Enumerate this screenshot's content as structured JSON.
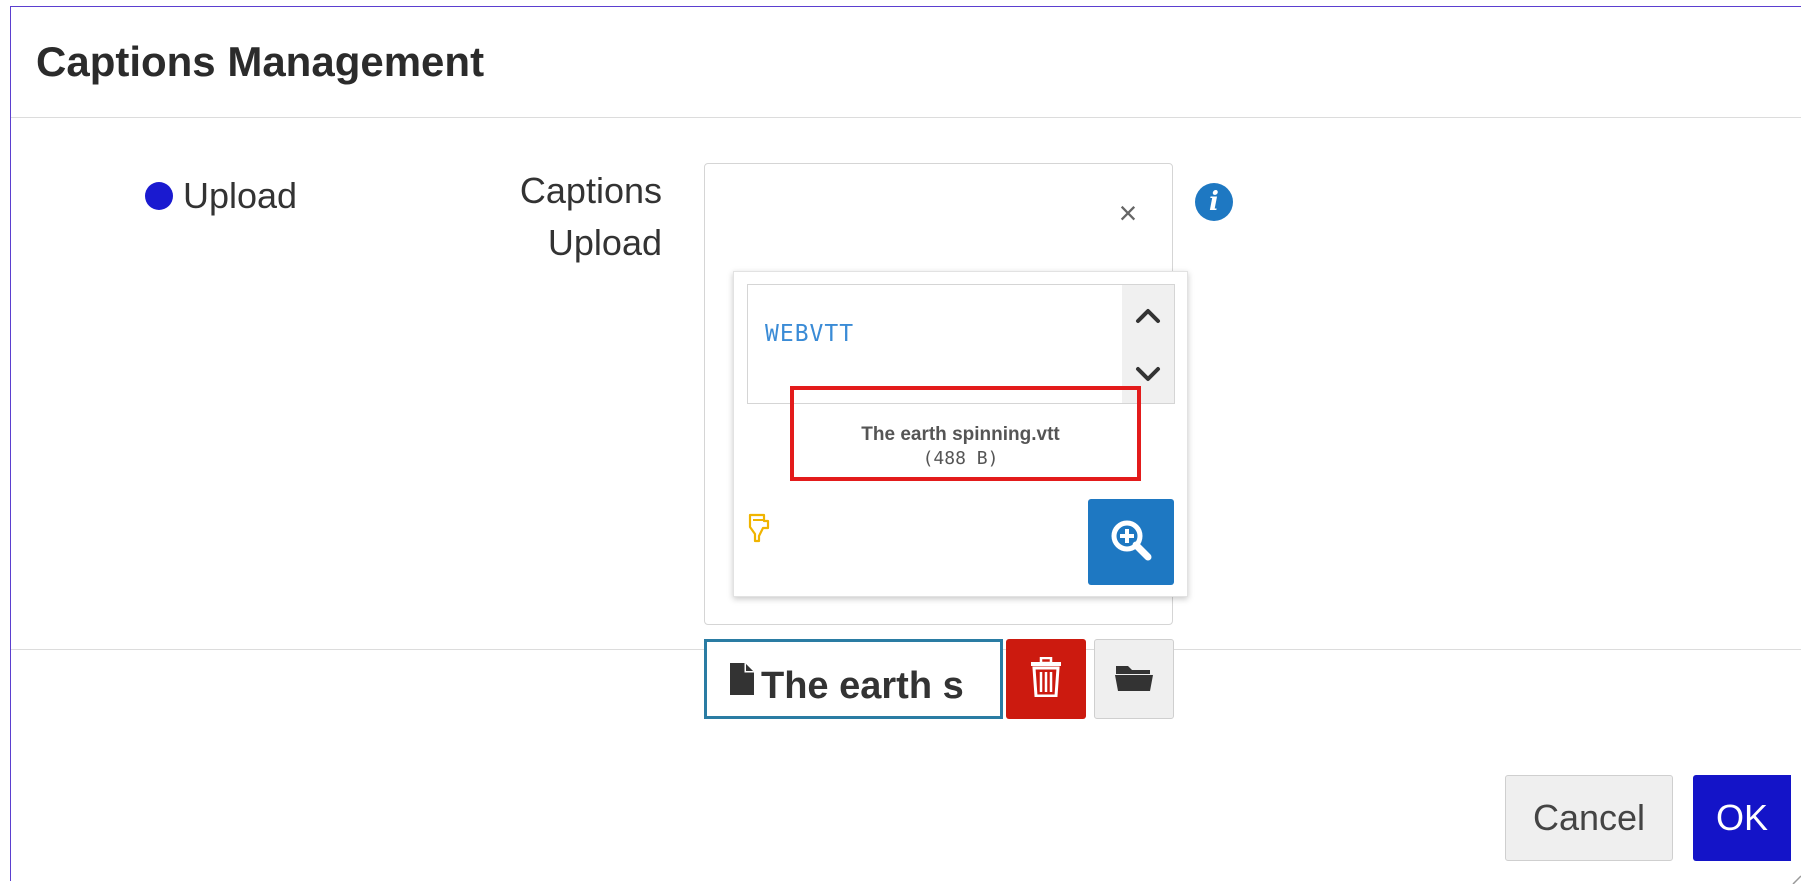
{
  "dialog": {
    "title": "Captions Management"
  },
  "form": {
    "radio_label": "Upload",
    "field_label_line1": "Captions",
    "field_label_line2": "Upload"
  },
  "preview": {
    "content_text": "WEBVTT",
    "file_name": "The earth spinning.vtt",
    "file_size": "(488 B)"
  },
  "file_input": {
    "value": "The earth s"
  },
  "footer": {
    "cancel_label": "Cancel",
    "ok_label": "OK"
  },
  "colors": {
    "radio": "#1a1ad0",
    "info": "#1e78c2",
    "zoom_button": "#1e78c2",
    "delete_button": "#cc1a0f",
    "ok_button": "#1414c8",
    "highlight": "#e31b1b",
    "preview_text": "#3a8bd6"
  },
  "icons": {
    "close": "close-icon",
    "info": "info-icon",
    "scroll_up": "chevron-up-icon",
    "scroll_down": "chevron-down-icon",
    "hand": "hand-pointer-icon",
    "zoom": "zoom-in-icon",
    "file": "file-icon",
    "delete": "trash-icon",
    "browse": "folder-icon"
  }
}
